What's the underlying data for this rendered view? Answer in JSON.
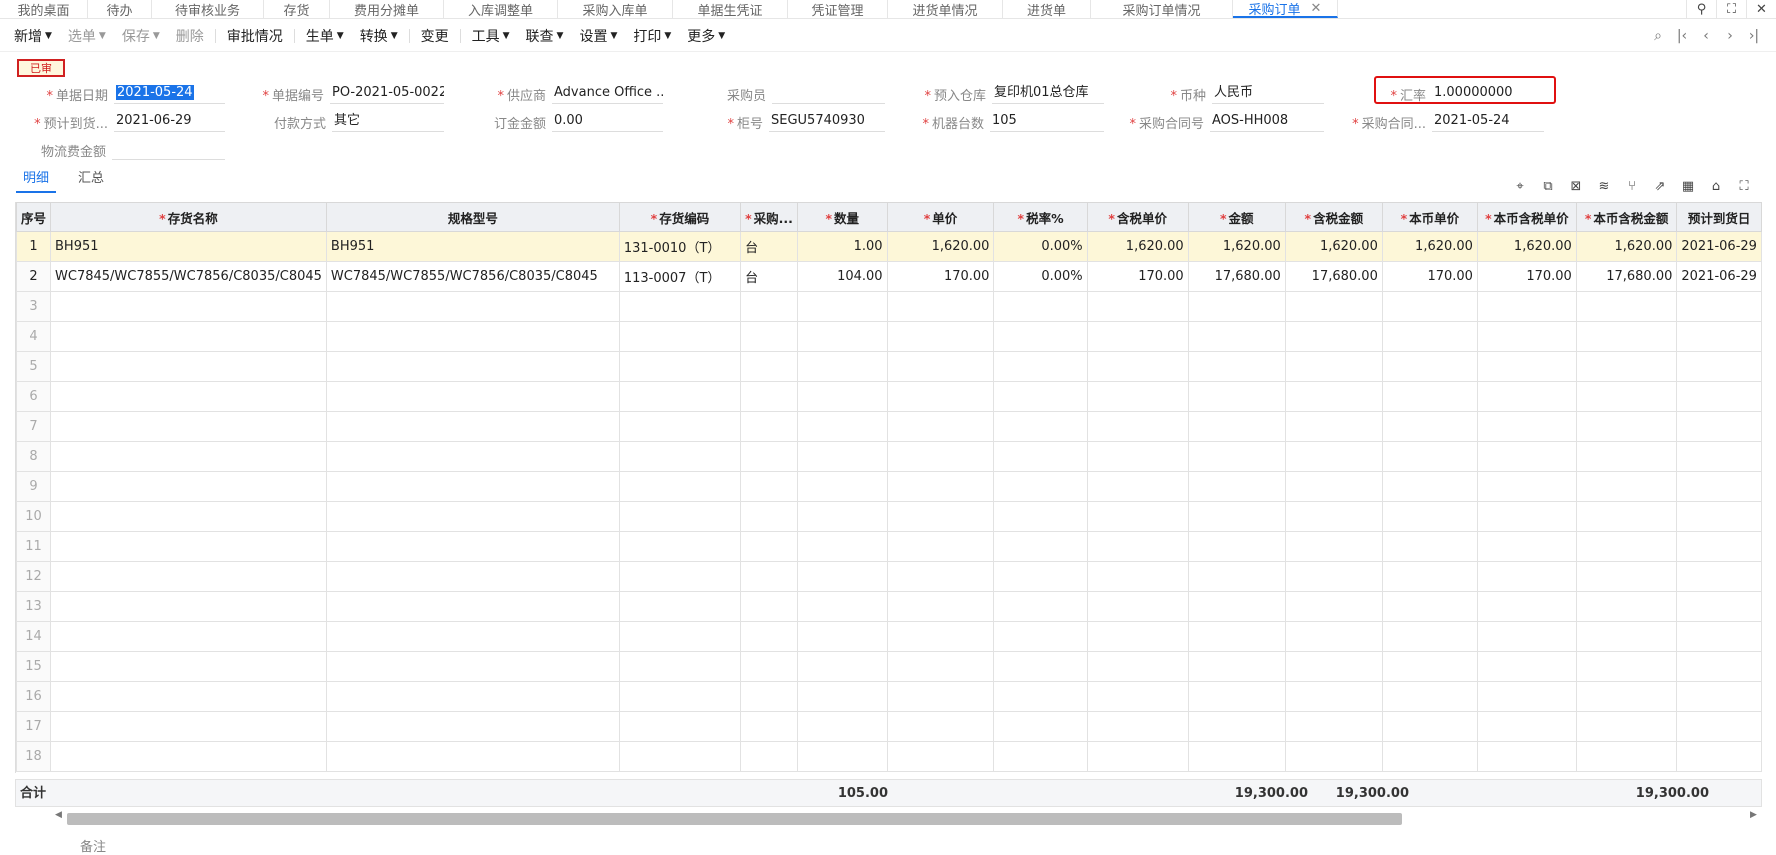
{
  "tabs": [
    {
      "label": "我的桌面"
    },
    {
      "label": "待办"
    },
    {
      "label": "待审核业务"
    },
    {
      "label": "存货"
    },
    {
      "label": "费用分摊单"
    },
    {
      "label": "入库调整单"
    },
    {
      "label": "采购入库单"
    },
    {
      "label": "单据生凭证"
    },
    {
      "label": "凭证管理"
    },
    {
      "label": "进货单情况"
    },
    {
      "label": "进货单"
    },
    {
      "label": "采购订单情况"
    },
    {
      "label": "采购订单"
    }
  ],
  "toolbar": {
    "new": "新增",
    "select": "选单",
    "save": "保存",
    "delete": "删除",
    "approval": "审批情况",
    "generate": "生单",
    "convert": "转换",
    "change": "变更",
    "tools": "工具",
    "query": "联查",
    "settings": "设置",
    "print": "打印",
    "more": "更多"
  },
  "status_badge": "已审",
  "form": {
    "doc_date_label": "单据日期",
    "doc_date": "2021-05-24",
    "doc_no_label": "单据编号",
    "doc_no": "PO-2021-05-0022",
    "supplier_label": "供应商",
    "supplier": "Advance Office ...",
    "buyer_label": "采购员",
    "buyer": "",
    "warehouse_label": "预入仓库",
    "warehouse": "复印机01总仓库",
    "currency_label": "币种",
    "currency": "人民币",
    "rate_label": "汇率",
    "rate": "1.00000000",
    "expected_label": "预计到货...",
    "expected": "2021-06-29",
    "payment_label": "付款方式",
    "payment": "其它",
    "deposit_label": "订金金额",
    "deposit": "0.00",
    "cabinet_label": "柜号",
    "cabinet": "SEGU5740930",
    "machines_label": "机器台数",
    "machines": "105",
    "contract_no_label": "采购合同号",
    "contract_no": "AOS-HH008",
    "contract_date_label": "采购合同...",
    "contract_date": "2021-05-24",
    "logistics_label": "物流费金额",
    "logistics": ""
  },
  "subtabs": {
    "detail": "明细",
    "summary": "汇总"
  },
  "grid": {
    "headers": [
      "序号",
      "存货名称",
      "规格型号",
      "存货编码",
      "采购...",
      "数量",
      "单价",
      "税率%",
      "含税单价",
      "金额",
      "含税金额",
      "本币单价",
      "本币含税单价",
      "本币含税金额",
      "预计到货日"
    ],
    "rows": [
      [
        "1",
        "BH951",
        "BH951",
        "131-0010（T）",
        "台",
        "1.00",
        "1,620.00",
        "0.00%",
        "1,620.00",
        "1,620.00",
        "1,620.00",
        "1,620.00",
        "1,620.00",
        "1,620.00",
        "2021-06-29"
      ],
      [
        "2",
        "WC7845/WC7855/WC7856/C8035/C8045",
        "WC7845/WC7855/WC7856/C8035/C8045",
        "113-0007（T）",
        "台",
        "104.00",
        "170.00",
        "0.00%",
        "170.00",
        "17,680.00",
        "17,680.00",
        "170.00",
        "170.00",
        "17,680.00",
        "2021-06-29"
      ]
    ],
    "empty_rows": [
      "3",
      "4",
      "5",
      "6",
      "7",
      "8",
      "9",
      "10",
      "11",
      "12",
      "13",
      "14",
      "15",
      "16",
      "17",
      "18"
    ]
  },
  "totals": {
    "label": "合计",
    "qty": "105.00",
    "amount": "19,300.00",
    "tax_amount": "19,300.00",
    "local_tax_amount": "19,300.00"
  },
  "remark_label": "备注"
}
